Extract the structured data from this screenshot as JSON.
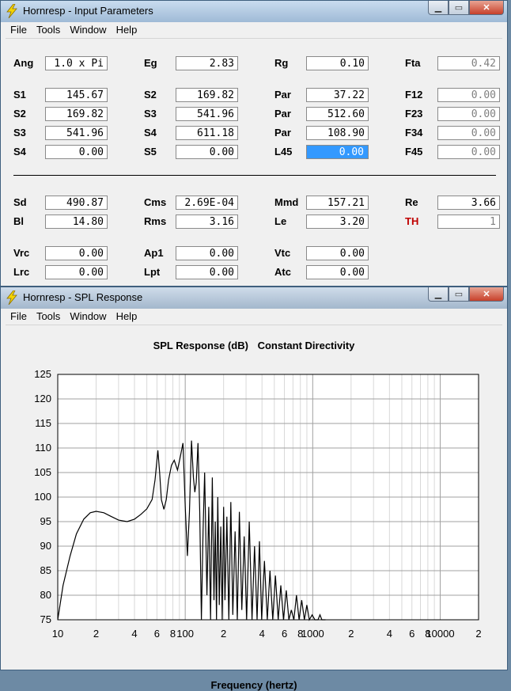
{
  "input_window": {
    "title": "Hornresp - Input Parameters",
    "menu": [
      "File",
      "Tools",
      "Window",
      "Help"
    ],
    "rows": [
      [
        {
          "label": "Ang",
          "value": "1.0 x Pi"
        },
        {
          "label": "Eg",
          "value": "2.83"
        },
        {
          "label": "Rg",
          "value": "0.10"
        },
        {
          "label": "Fta",
          "value": "0.42"
        }
      ],
      [
        {
          "label": "S1",
          "value": "145.67"
        },
        {
          "label": "S2",
          "value": "169.82"
        },
        {
          "label": "Par",
          "value": "37.22"
        },
        {
          "label": "F12",
          "value": "0.00"
        }
      ],
      [
        {
          "label": "S2",
          "value": "169.82"
        },
        {
          "label": "S3",
          "value": "541.96"
        },
        {
          "label": "Par",
          "value": "512.60"
        },
        {
          "label": "F23",
          "value": "0.00"
        }
      ],
      [
        {
          "label": "S3",
          "value": "541.96"
        },
        {
          "label": "S4",
          "value": "611.18"
        },
        {
          "label": "Par",
          "value": "108.90"
        },
        {
          "label": "F34",
          "value": "0.00"
        }
      ],
      [
        {
          "label": "S4",
          "value": "0.00"
        },
        {
          "label": "S5",
          "value": "0.00"
        },
        {
          "label": "L45",
          "value": "0.00"
        },
        {
          "label": "F45",
          "value": "0.00"
        }
      ],
      [
        {
          "label": "Sd",
          "value": "490.87"
        },
        {
          "label": "Cms",
          "value": "2.69E-04"
        },
        {
          "label": "Mmd",
          "value": "157.21"
        },
        {
          "label": "Re",
          "value": "3.66"
        }
      ],
      [
        {
          "label": "Bl",
          "value": "14.80"
        },
        {
          "label": "Rms",
          "value": "3.16"
        },
        {
          "label": "Le",
          "value": "3.20"
        },
        {
          "label": "TH",
          "value": "1"
        }
      ],
      [
        {
          "label": "Vrc",
          "value": "0.00"
        },
        {
          "label": "Ap1",
          "value": "0.00"
        },
        {
          "label": "Vtc",
          "value": "0.00"
        }
      ],
      [
        {
          "label": "Lrc",
          "value": "0.00"
        },
        {
          "label": "Lpt",
          "value": "0.00"
        },
        {
          "label": "Atc",
          "value": "0.00"
        }
      ]
    ]
  },
  "spl_window": {
    "title": "Hornresp - SPL Response",
    "menu": [
      "File",
      "Tools",
      "Window",
      "Help"
    ],
    "chart_title_left": "SPL Response (dB)",
    "chart_title_right": "Constant Directivity"
  },
  "colors": {
    "selection": "#3399ff",
    "label_red": "#c00000",
    "grid_major": "#a0a0a0",
    "grid_minor": "#d8d8d8",
    "curve": "#000000"
  },
  "chart_data": {
    "type": "line",
    "title": "SPL Response (dB)   Constant Directivity",
    "xlabel": "Frequency (hertz)",
    "ylabel": "",
    "xscale": "log",
    "xlim": [
      10,
      20000
    ],
    "ylim": [
      75,
      125
    ],
    "yticks": [
      75,
      80,
      85,
      90,
      95,
      100,
      105,
      110,
      115,
      120,
      125
    ],
    "xtick_labels": [
      "10",
      "2",
      "4",
      "6",
      "8",
      "100",
      "2",
      "4",
      "6",
      "8",
      "1000",
      "2",
      "4",
      "6",
      "8",
      "10000",
      "2"
    ],
    "grid": true,
    "series": [
      {
        "x": [
          10,
          11,
          12.5,
          14,
          16,
          18,
          20,
          23,
          26,
          30,
          35,
          40,
          45,
          50,
          55,
          58,
          61,
          63,
          65,
          68,
          71,
          74,
          78,
          82,
          87,
          92,
          96,
          100,
          104,
          108,
          112,
          116,
          119,
          122,
          126,
          130,
          134,
          138,
          142,
          148,
          153,
          158,
          163,
          168,
          172,
          176,
          180,
          185,
          190,
          195,
          200,
          205,
          212,
          220,
          228,
          236,
          246,
          256,
          266,
          278,
          290,
          303,
          318,
          334,
          350,
          366,
          382,
          398,
          418,
          440,
          462,
          486,
          510,
          536,
          562,
          590,
          620,
          650,
          680,
          712,
          746,
          782,
          820,
          860,
          900,
          940,
          990,
          1040,
          1100,
          1140,
          1180,
          1220,
          1260
        ],
        "values": [
          75,
          82,
          88,
          92.5,
          95.5,
          96.8,
          97.1,
          96.8,
          96.1,
          95.3,
          95.0,
          95.5,
          96.5,
          97.6,
          99.5,
          103.5,
          109.5,
          105,
          99.5,
          97.5,
          99.5,
          103.5,
          106.5,
          107.5,
          105.5,
          108.5,
          111,
          98,
          88,
          97,
          111.5,
          104,
          101,
          103,
          111,
          97,
          75,
          93,
          105,
          80,
          98,
          75,
          104,
          79,
          95,
          75,
          100,
          78,
          94,
          75,
          98,
          79,
          96,
          75,
          99,
          76,
          93,
          75,
          97,
          77,
          92,
          75,
          95,
          75,
          90,
          75,
          91,
          75,
          87,
          75,
          85,
          75,
          84,
          75,
          82,
          75,
          81,
          75,
          77,
          75,
          80,
          75,
          79,
          75,
          78,
          75,
          76,
          75,
          75,
          76,
          75,
          75,
          75
        ]
      }
    ]
  }
}
